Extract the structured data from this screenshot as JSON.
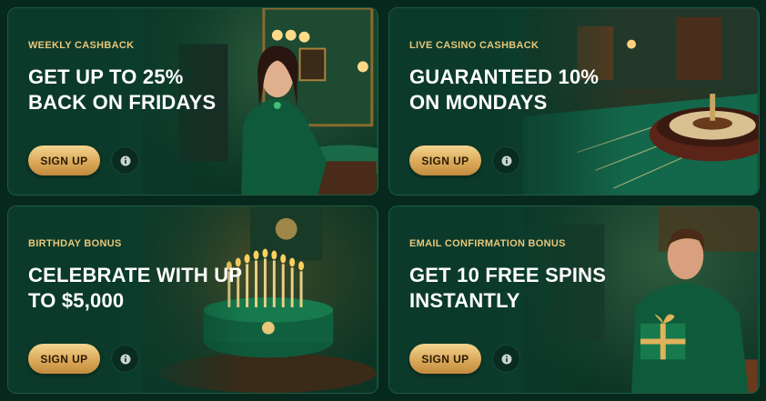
{
  "promos": [
    {
      "eyebrow": "WEEKLY CASHBACK",
      "headline": "GET UP TO 25% BACK ON FRIDAYS",
      "button": "SIGN UP",
      "info_icon": "info-icon"
    },
    {
      "eyebrow": "LIVE CASINO CASHBACK",
      "headline": "GUARANTEED 10% ON MONDAYS",
      "button": "SIGN UP",
      "info_icon": "info-icon"
    },
    {
      "eyebrow": "BIRTHDAY BONUS",
      "headline": "CELEBRATE WITH UP TO $5,000",
      "button": "SIGN UP",
      "info_icon": "info-icon"
    },
    {
      "eyebrow": "EMAIL CONFIRMATION BONUS",
      "headline": "GET 10 FREE SPINS INSTANTLY",
      "button": "SIGN UP",
      "info_icon": "info-icon"
    }
  ],
  "colors": {
    "card_bg": "#0d4430",
    "eyebrow": "#e8c67a",
    "button_gold": "#dba95a",
    "page_bg": "#07281d"
  }
}
